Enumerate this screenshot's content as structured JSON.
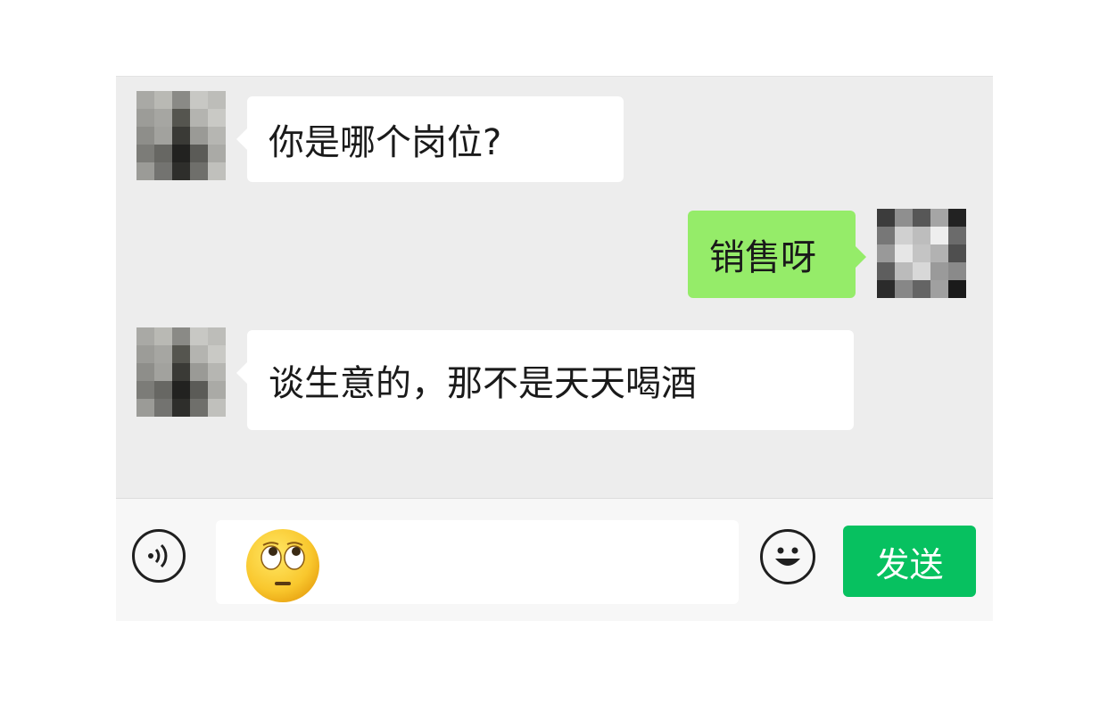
{
  "chat": {
    "messages": [
      {
        "sender": "contact",
        "text": "你是哪个岗位?"
      },
      {
        "sender": "me",
        "text": "销售呀"
      },
      {
        "sender": "contact",
        "text": "谈生意的，那不是天天喝酒"
      }
    ]
  },
  "input_bar": {
    "voice_icon": "voice-icon",
    "input_emoji": "face-with-rolling-eyes",
    "emoji_icon": "smiley-icon",
    "send_label": "发送"
  },
  "colors": {
    "background": "#ededed",
    "incoming_bubble": "#ffffff",
    "outgoing_bubble": "#95ec69",
    "send_button": "#07c160"
  }
}
